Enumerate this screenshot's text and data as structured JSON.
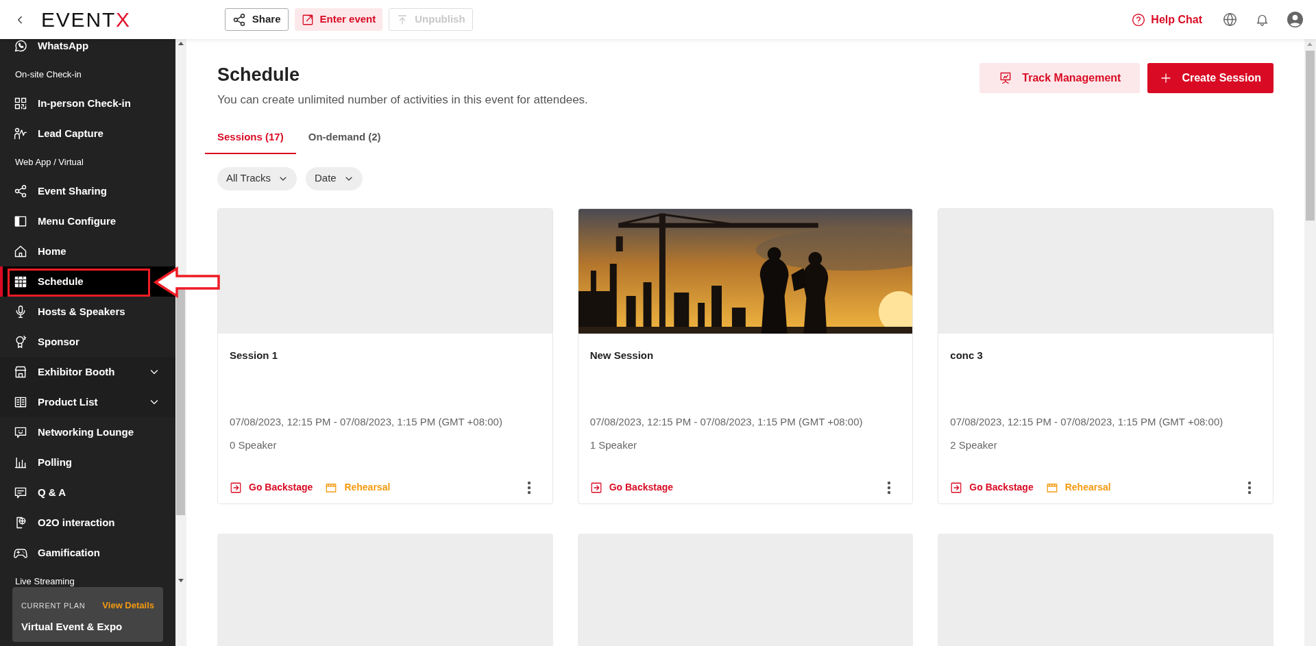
{
  "topbar": {
    "logo": {
      "text": "EVENT",
      "accent": "X"
    },
    "buttons": [
      {
        "kind": "share",
        "label": "Share",
        "disabled": false
      },
      {
        "kind": "enter",
        "label": "Enter event",
        "disabled": false
      },
      {
        "kind": "unpublish",
        "label": "Unpublish",
        "disabled": true
      }
    ],
    "help": "Help Chat"
  },
  "sidebar": {
    "items": [
      {
        "kind": "item",
        "label": "WhatsApp",
        "selected": false
      },
      {
        "kind": "section",
        "label": "On-site Check-in"
      },
      {
        "kind": "item",
        "label": "In-person Check-in",
        "selected": false
      },
      {
        "kind": "item",
        "label": "Lead Capture",
        "selected": false
      },
      {
        "kind": "section",
        "label": "Web App / Virtual"
      },
      {
        "kind": "item",
        "label": "Event Sharing",
        "selected": false
      },
      {
        "kind": "item",
        "label": "Menu Configure",
        "selected": false
      },
      {
        "kind": "item",
        "label": "Home",
        "selected": false
      },
      {
        "kind": "item",
        "label": "Schedule",
        "selected": true
      },
      {
        "kind": "item",
        "label": "Hosts & Speakers",
        "selected": false
      },
      {
        "kind": "item",
        "label": "Sponsor",
        "selected": false
      },
      {
        "kind": "item",
        "label": "Exhibitor Booth",
        "selected": false,
        "expanded": false
      },
      {
        "kind": "item",
        "label": "Product List",
        "selected": false,
        "expanded": false
      },
      {
        "kind": "item",
        "label": "Networking Lounge",
        "selected": false
      },
      {
        "kind": "item",
        "label": "Polling",
        "selected": false
      },
      {
        "kind": "item",
        "label": "Q & A",
        "selected": false
      },
      {
        "kind": "item",
        "label": "O2O interaction",
        "selected": false
      },
      {
        "kind": "item",
        "label": "Gamification",
        "selected": false
      },
      {
        "kind": "section",
        "label": "Live Streaming"
      }
    ],
    "plan": {
      "caption": "CURRENT PLAN",
      "link": "View Details",
      "name": "Virtual Event & Expo"
    }
  },
  "page": {
    "title": "Schedule",
    "subtitle": "You can create unlimited number of activities in this event for attendees.",
    "actions": [
      {
        "kind": "secondary",
        "label": "Track Management"
      },
      {
        "kind": "primary",
        "label": "Create Session"
      }
    ],
    "tabs": [
      {
        "label": "Sessions (17)",
        "selected": true
      },
      {
        "label": "On-demand (2)",
        "selected": false
      }
    ],
    "filters": [
      "All Tracks",
      "Date"
    ],
    "cards": [
      {
        "has_image": false,
        "title": "Session 1",
        "time": "07/08/2023, 12:15 PM - 07/08/2023, 1:15 PM (GMT +08:00)",
        "speakers": "0 Speaker",
        "actions": [
          {
            "kind": "backstage",
            "label": "Go Backstage"
          },
          {
            "kind": "rehearsal",
            "label": "Rehearsal"
          }
        ]
      },
      {
        "has_image": true,
        "title": "New Session",
        "time": "07/08/2023, 12:15 PM - 07/08/2023, 1:15 PM (GMT +08:00)",
        "speakers": "1 Speaker",
        "actions": [
          {
            "kind": "backstage",
            "label": "Go Backstage"
          }
        ]
      },
      {
        "has_image": false,
        "title": "conc 3",
        "time": "07/08/2023, 12:15 PM - 07/08/2023, 1:15 PM (GMT +08:00)",
        "speakers": "2 Speaker",
        "actions": [
          {
            "kind": "backstage",
            "label": "Go Backstage"
          },
          {
            "kind": "rehearsal",
            "label": "Rehearsal"
          }
        ]
      },
      {
        "has_image": false
      },
      {
        "has_image": false
      },
      {
        "has_image": false
      }
    ]
  }
}
